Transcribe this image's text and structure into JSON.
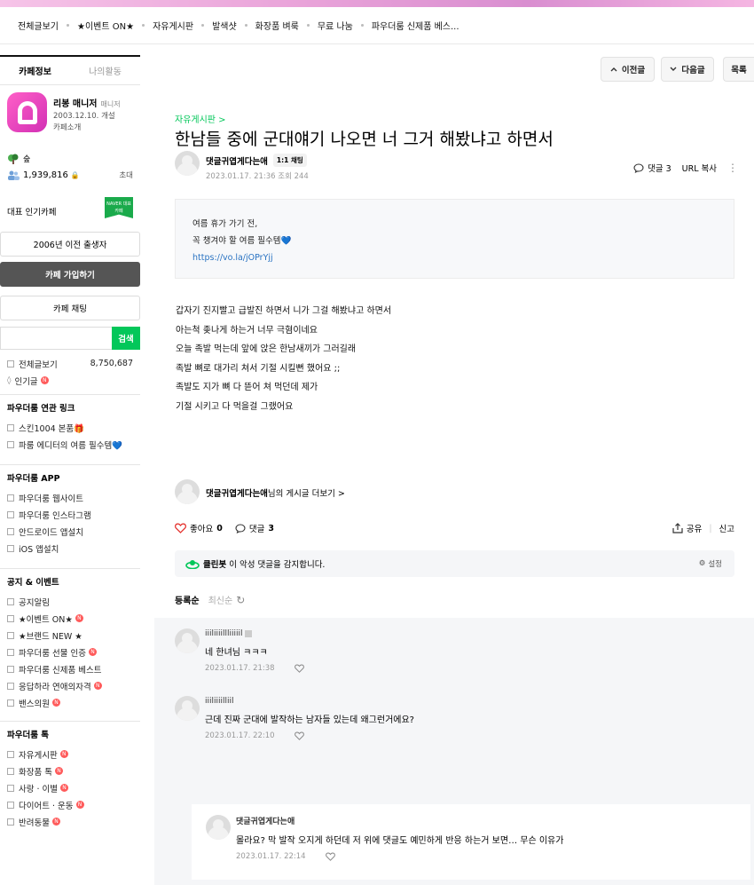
{
  "menu": [
    "전체글보기",
    "★이벤트 ON★",
    "자유게시판",
    "발색샷",
    "화장품 벼룩",
    "무료 나눔",
    "파우더룸 신제품 베스..."
  ],
  "sidebar": {
    "tab_cafe": "카페정보",
    "tab_my": "나의활동",
    "cafe_name": "리봉 매니저",
    "manager_label": "매니저",
    "founded": "2003.12.10. 개설",
    "intro": "카페소개",
    "rank": "숲",
    "members": "1,939,816",
    "invite": "초대",
    "rep_label": "대표 인기카페",
    "naver_badge": "NAVER 대표카페",
    "born_before": "2006년 이전 출생자",
    "join_button": "카페 가입하기",
    "chat_button": "카페 채팅",
    "search_button": "검색",
    "all_posts": "전체글보기",
    "all_posts_count": "8,750,687",
    "popular": "인기글",
    "sections": [
      {
        "title": "파우더룸 연관 링크",
        "items": [
          "스킨1004 본품🎁",
          "파룸 에디터의 여름 필수템💙"
        ]
      },
      {
        "title": "파우더룸 APP",
        "items": [
          "파우더룸 웹사이트",
          "파우더룸 인스타그램",
          "안드로이드 앱설치",
          "iOS 앱설치"
        ]
      },
      {
        "title": "공지 & 이벤트",
        "items": [
          "공지알림",
          "★이벤트 ON★",
          "★브랜드 NEW ★",
          "파우더룸 선물 인증",
          "파우더룸 신제품 베스트",
          "응답하라 연애의자격",
          "밴스의원"
        ]
      },
      {
        "title": "파우더룸 톡",
        "items": [
          "자유게시판",
          "화장품 톡",
          "사랑 · 이별",
          "다이어트 · 운동",
          "반려동물"
        ]
      }
    ]
  },
  "nav": {
    "prev": "이전글",
    "next": "다음글",
    "list": "목록"
  },
  "article": {
    "board": "자유게시판 >",
    "title": "한남들 중에 군대얘기 나오면 너 그거 해봤냐고 하면서",
    "author": "댓글귀엽게다는애",
    "chat_badge": "1:1 채팅",
    "meta": "2023.01.17. 21:36  조회 244",
    "comment_count_label": "댓글 3",
    "url_copy": "URL 복사",
    "promo_line1": "여름 휴가 가기 전,",
    "promo_line2": "꼭 챙겨야 할 여름 필수템💙",
    "promo_link": "https://vo.la/jOPrYjj",
    "body": [
      "갑자기 진지빨고 급발진 하면서 니가 그걸 해봤냐고 하면서",
      "아는척 좆나게 하는거 너무 극혐이네요",
      "오늘 족발 먹는데 앞에 앉은 한남새끼가 그러길래",
      "족발 뼈로 대가리 쳐서 기절 시킬뻔 했어요 ;;",
      "족발도 지가 뼈 다 뜯어 쳐 먹던데 제가",
      "기절 시키고 다 먹을걸 그랬어요"
    ],
    "more_author": "댓글귀엽게다는애",
    "more_suffix": "님의 게시글 더보기 >",
    "like_label": "좋아요",
    "like_count": "0",
    "comment_label": "댓글",
    "comment_count": "3",
    "share": "공유",
    "report": "신고",
    "cleanbot_name": "클린봇",
    "cleanbot_text": "이 악성 댓글을 감지합니다.",
    "settings": "설정",
    "sort_reg": "등록순",
    "sort_new": "최신순"
  },
  "comments": [
    {
      "name": "iiiliiiillliiiiil",
      "text": "네 한녀님 ㅋㅋㅋ",
      "date": "2023.01.17. 21:38"
    },
    {
      "name": "iiiliiiilliil",
      "text": "근데 진짜 군대에 발작하는 남자들 있는데 왜그런거에요?",
      "date": "2023.01.17. 22:10"
    },
    {
      "name": "댓글귀엽게다는애",
      "text": "몰라요? 막 발작 오지게 하던데 저 위에 댓글도 예민하게 반응 하는거 보면… 무슨 이유가",
      "date": "2023.01.17. 22:14"
    }
  ]
}
